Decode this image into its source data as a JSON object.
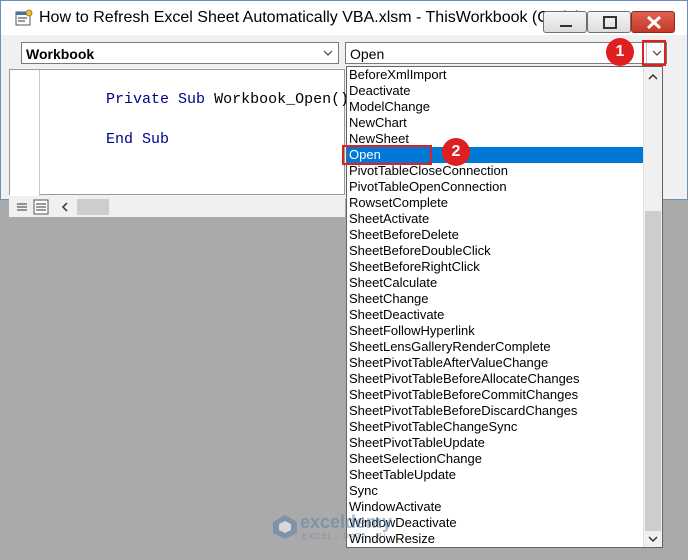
{
  "window": {
    "title": "How to Refresh Excel Sheet Automatically VBA.xlsm - ThisWorkbook (Code)"
  },
  "object_combo": {
    "value": "Workbook"
  },
  "procedure_combo": {
    "value": "Open"
  },
  "code": {
    "line1_kw1": "Private",
    "line1_kw2": "Sub",
    "line1_name": "Workbook_Open()",
    "line2_kw1": "End",
    "line2_kw2": "Sub"
  },
  "dropdown": {
    "items": [
      "BeforeXmlImport",
      "Deactivate",
      "ModelChange",
      "NewChart",
      "NewSheet",
      "Open",
      "PivotTableCloseConnection",
      "PivotTableOpenConnection",
      "RowsetComplete",
      "SheetActivate",
      "SheetBeforeDelete",
      "SheetBeforeDoubleClick",
      "SheetBeforeRightClick",
      "SheetCalculate",
      "SheetChange",
      "SheetDeactivate",
      "SheetFollowHyperlink",
      "SheetLensGalleryRenderComplete",
      "SheetPivotTableAfterValueChange",
      "SheetPivotTableBeforeAllocateChanges",
      "SheetPivotTableBeforeCommitChanges",
      "SheetPivotTableBeforeDiscardChanges",
      "SheetPivotTableChangeSync",
      "SheetPivotTableUpdate",
      "SheetSelectionChange",
      "SheetTableUpdate",
      "Sync",
      "WindowActivate",
      "WindowDeactivate",
      "WindowResize"
    ],
    "selected_index": 5
  },
  "badges": {
    "one": "1",
    "two": "2"
  },
  "watermark": {
    "name": "exceldemy",
    "tagline": "EXCEL · DATA · BI"
  },
  "colors": {
    "selection": "#0078d7",
    "annotation": "#e02020",
    "keyword": "#00008b"
  }
}
